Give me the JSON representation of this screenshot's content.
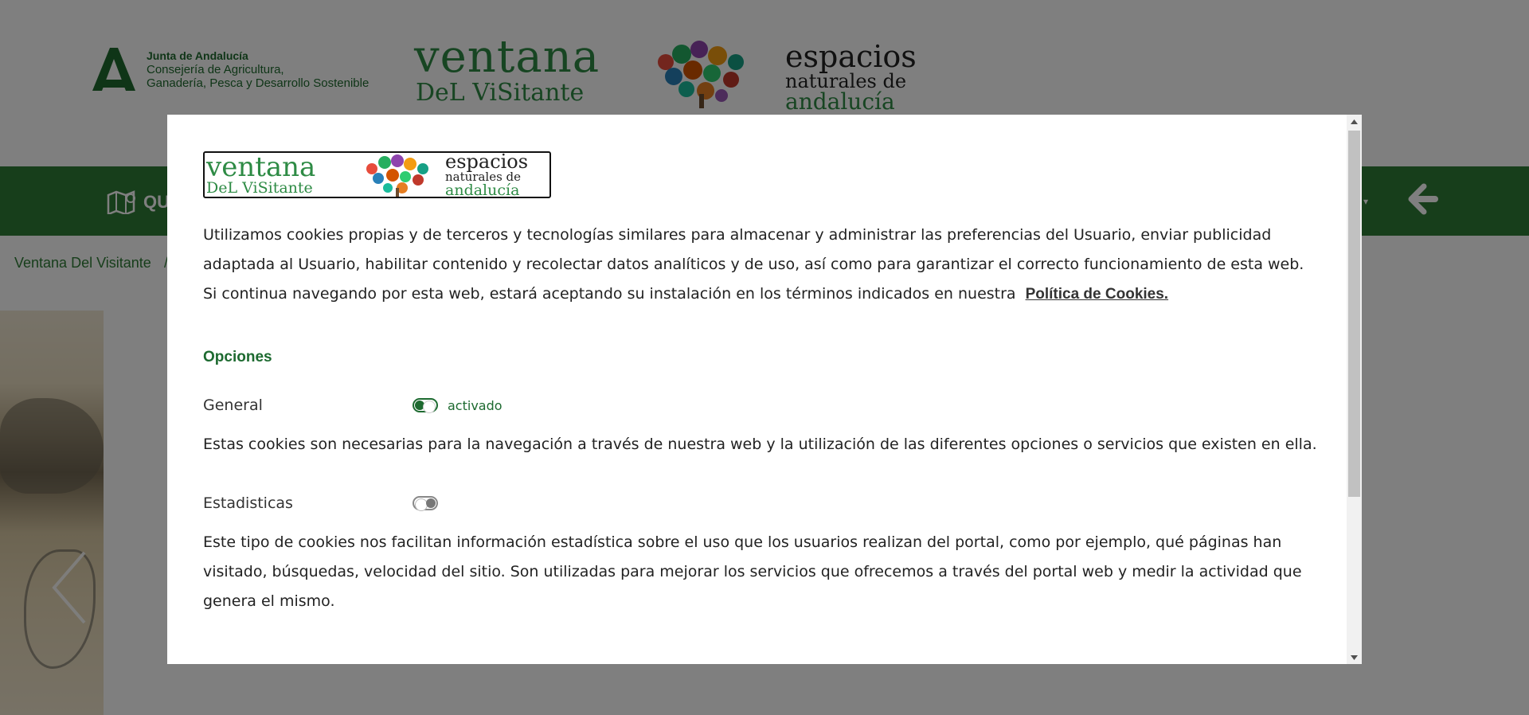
{
  "header": {
    "junta_line1": "Junta de Andalucía",
    "junta_line2": "Consejería de Agricultura,",
    "junta_line3": "Ganadería, Pesca y Desarrollo Sostenible",
    "ventana_line1": "ventana",
    "ventana_line2": "DeL ViSitante",
    "espacios_line1": "espacios",
    "espacios_line2": "naturales de",
    "espacios_line3": "andalucía"
  },
  "nav": {
    "first_item_label": "QU",
    "caret_icon": "chevron-down-icon",
    "back_icon": "arrow-left-icon"
  },
  "breadcrumb": {
    "home": "Ventana Del Visitante",
    "separator": "/"
  },
  "modal": {
    "logo": {
      "ventana_line1": "ventana",
      "ventana_line2": "DeL ViSitante",
      "espacios_line1": "espacios",
      "espacios_line2": "naturales de",
      "espacios_line3": "andalucía"
    },
    "intro_text": "Utilizamos cookies propias y de terceros y tecnologías similares para almacenar y administrar las preferencias del Usuario, enviar publicidad adaptada al Usuario, habilitar contenido y recolectar datos analíticos y de uso, así como para garantizar el correcto funcionamiento de esta web. Si continua navegando por esta web, estará aceptando su instalación en los términos indicados en nuestra",
    "policy_link": "Política de Cookies.",
    "options_title": "Opciones",
    "options": [
      {
        "label": "General",
        "enabled": true,
        "state_text": "activado",
        "description": "Estas cookies son necesarias para la navegación a través de nuestra web y la utilización de las diferentes opciones o servicios que existen en ella."
      },
      {
        "label": "Estadisticas",
        "enabled": false,
        "state_text": "",
        "description": "Este tipo de cookies nos facilitan información estadística sobre el uso que los usuarios realizan del portal, como por ejemplo, qué páginas han visitado, búsquedas, velocidad del sitio. Son utilizadas para mejorar los servicios que ofrecemos a través del portal web y medir la actividad que genera el mismo."
      }
    ]
  },
  "colors": {
    "brand_green": "#2f7d36",
    "accent_green": "#1d6a30",
    "overlay": "rgba(0,0,0,0.5)"
  }
}
